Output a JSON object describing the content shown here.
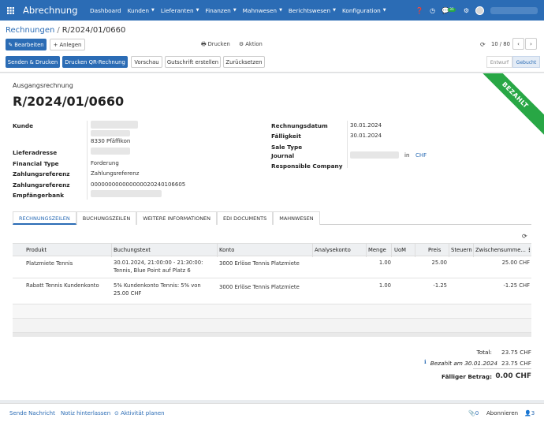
{
  "navbar": {
    "app_title": "Abrechnung",
    "menu": [
      {
        "label": "Dashboard",
        "has_caret": false
      },
      {
        "label": "Kunden",
        "has_caret": true
      },
      {
        "label": "Lieferanten",
        "has_caret": true
      },
      {
        "label": "Finanzen",
        "has_caret": true
      },
      {
        "label": "Mahnwesen",
        "has_caret": true
      },
      {
        "label": "Berichtswesen",
        "has_caret": true
      },
      {
        "label": "Konfiguration",
        "has_caret": true
      }
    ],
    "chat_badge": "31",
    "icons": [
      "help-icon",
      "clock-icon",
      "chat-icon",
      "settings-icon",
      "avatar"
    ]
  },
  "breadcrumb": {
    "parent": "Rechnungen",
    "separator": "/",
    "current": "R/2024/01/0660"
  },
  "toolbar": {
    "edit": "✎ Bearbeiten",
    "create": "+ Anlegen",
    "print": "🖶 Drucken",
    "action": "⚙ Aktion",
    "pager": "10 / 80"
  },
  "actions": {
    "send_print": "Senden & Drucken",
    "print_qr": "Drucken QR-Rechnung",
    "preview": "Vorschau",
    "credit_note": "Gutschrift erstellen",
    "reset": "Zurücksetzen"
  },
  "status": {
    "draft": "Entwurf",
    "posted": "Gebucht",
    "ribbon": "BEZAHLT"
  },
  "document": {
    "type": "Ausgangsrechnung",
    "number": "R/2024/01/0660",
    "left_fields": {
      "customer_label": "Kunde",
      "customer_city": "8330 Pfäffikon",
      "delivery_label": "Lieferadresse",
      "financial_type_label": "Financial Type",
      "financial_type_value": "Forderung",
      "payment_ref_label_1": "Zahlungsreferenz",
      "payment_ref_value_1": "Zahlungsreferenz",
      "payment_ref_label_2": "Zahlungsreferenz",
      "payment_ref_value_2": "000000000000000020240106605",
      "bank_label": "Empfängerbank"
    },
    "right_fields": {
      "invoice_date_label": "Rechnungsdatum",
      "invoice_date_value": "30.01.2024",
      "due_label": "Fälligkeit",
      "due_value": "30.01.2024",
      "sale_type_label": "Sale Type",
      "journal_label": "Journal",
      "journal_in": "in",
      "journal_currency": "CHF",
      "company_label": "Responsible Company"
    }
  },
  "tabs": [
    "RECHNUNGSZEILEN",
    "BUCHUNGSZEILEN",
    "WEITERE INFORMATIONEN",
    "EDI DOCUMENTS",
    "MAHNWESEN"
  ],
  "table": {
    "headers": {
      "product": "Produkt",
      "text": "Buchungstext",
      "account": "Konto",
      "analytic": "Analysekonto",
      "qty": "Menge",
      "uom": "UoM",
      "price": "Preis",
      "taxes": "Steuern",
      "subtotal": "Zwischensumme..."
    },
    "rows": [
      {
        "product": "Platzmiete Tennis",
        "text_1": "30.01.2024, 21:00:00 - 21:30:00:",
        "text_2": "Tennis, Blue Point auf Platz 6",
        "account": "3000 Erlöse Tennis Platzmiete",
        "qty": "1.00",
        "price": "25.00",
        "subtotal": "25.00 CHF"
      },
      {
        "product": "Rabatt Tennis Kundenkonto",
        "text_1": "5% Kundenkonto Tennis: 5% von",
        "text_2": "25.00 CHF",
        "account": "3000 Erlöse Tennis Platzmiete",
        "qty": "1.00",
        "price": "-1.25",
        "subtotal": "-1.25 CHF"
      }
    ]
  },
  "totals": {
    "total_label": "Total:",
    "total_value": "23.75 CHF",
    "paid_label": "Bezahlt am 30.01.2024",
    "paid_value": "23.75 CHF",
    "due_label": "Fälliger Betrag:",
    "due_value": "0.00 CHF"
  },
  "chatter": {
    "send_message": "Sende Nachricht",
    "log_note": "Notiz hinterlassen",
    "schedule": "⊙ Aktivität planen",
    "attachments": "0",
    "follow": "Abonnieren",
    "followers": "3"
  }
}
